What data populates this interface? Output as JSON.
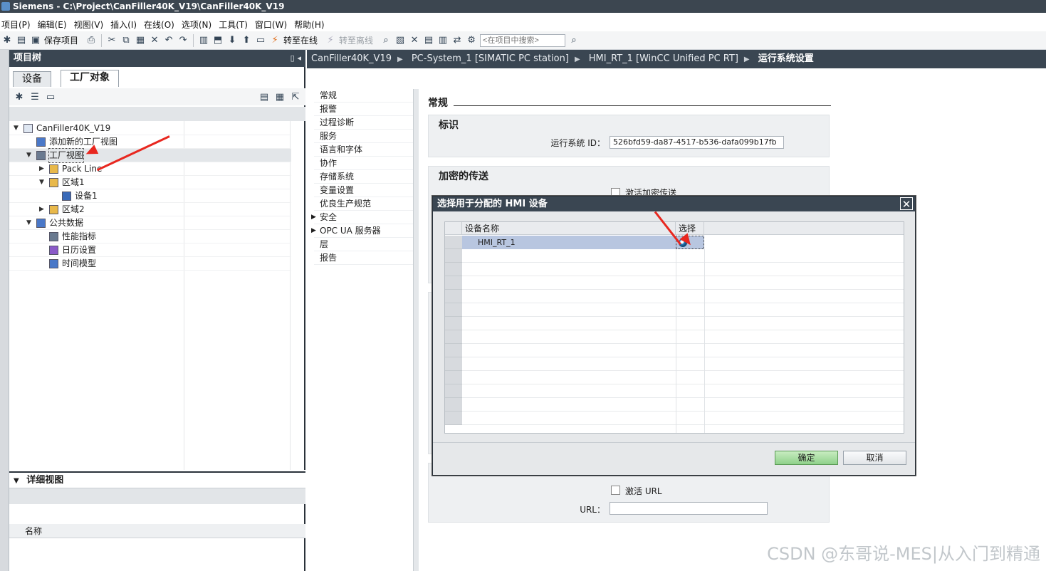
{
  "window": {
    "title": "Siemens  -  C:\\Project\\CanFiller40K_V19\\CanFiller40K_V19"
  },
  "menu": [
    "项目(P)",
    "编辑(E)",
    "视图(V)",
    "插入(I)",
    "在线(O)",
    "选项(N)",
    "工具(T)",
    "窗口(W)",
    "帮助(H)"
  ],
  "toolbar": {
    "save_label": "保存项目",
    "go_online": "转至在线",
    "go_offline": "转至离线",
    "search_placeholder": "<在项目中搜索>"
  },
  "project_tree": {
    "title": "项目树",
    "tabs": [
      "设备",
      "工厂对象"
    ],
    "items": [
      {
        "label": "CanFiller40K_V19",
        "indent": 0,
        "expanded": true
      },
      {
        "label": "添加新的工厂视图",
        "indent": 1
      },
      {
        "label": "工厂视图",
        "indent": 1,
        "expanded": true,
        "selected": true
      },
      {
        "label": "Pack Line",
        "indent": 2,
        "expanded": false
      },
      {
        "label": "区域1",
        "indent": 2,
        "expanded": true
      },
      {
        "label": "设备1",
        "indent": 3
      },
      {
        "label": "区域2",
        "indent": 2,
        "expanded": false
      },
      {
        "label": "公共数据",
        "indent": 1,
        "expanded": true
      },
      {
        "label": "性能指标",
        "indent": 2
      },
      {
        "label": "日历设置",
        "indent": 2
      },
      {
        "label": "时间模型",
        "indent": 2
      }
    ]
  },
  "detail_view": {
    "title": "详细视图",
    "column": "名称"
  },
  "breadcrumb": [
    "CanFiller40K_V19",
    "PC-System_1 [SIMATIC PC station]",
    "HMI_RT_1 [WinCC Unified PC RT]",
    "运行系统设置"
  ],
  "settings_nav": [
    "常规",
    "报警",
    "过程诊断",
    "服务",
    "语言和字体",
    "协作",
    "存储系统",
    "变量设置",
    "优良生产规范",
    "安全",
    "OPC UA 服务器",
    "层",
    "报告"
  ],
  "general": {
    "title": "常规",
    "identity_title": "标识",
    "runtime_id_label": "运行系统 ID：",
    "runtime_id_value": "526bfd59-da87-4517-b536-dafa099b17fb",
    "encrypted_title": "加密的传送",
    "activate_encrypt": "激活加密传送",
    "activate_url": "激活 URL",
    "url_label": "URL："
  },
  "dialog": {
    "title": "选择用于分配的 HMI 设备",
    "col_device": "设备名称",
    "col_select": "选择",
    "row_device": "HMI_RT_1",
    "ok": "确定",
    "cancel": "取消"
  },
  "watermark": "CSDN @东哥说-MES|从入门到精通",
  "colors": {
    "header": "#3a4652",
    "accent_red": "#e8271f",
    "ok_green": "#8fd18a"
  }
}
